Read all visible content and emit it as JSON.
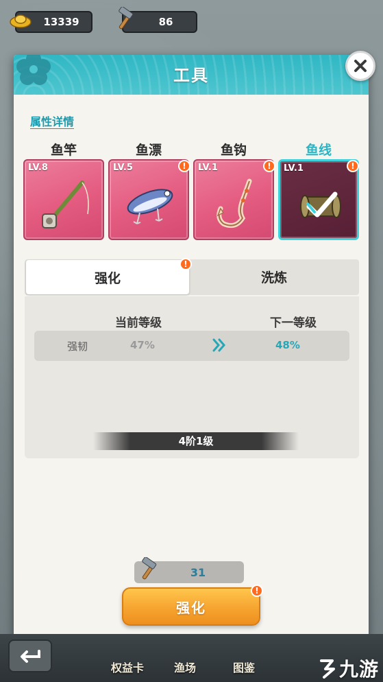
{
  "resources": {
    "gold": "13339",
    "hammers": "86"
  },
  "dialog": {
    "title": "工具",
    "section_link": "属性详情",
    "categories": [
      {
        "label": "鱼竿",
        "level": "LV.8",
        "alert": false,
        "selected": false,
        "icon": "fishing-rod-icon"
      },
      {
        "label": "鱼漂",
        "level": "LV.5",
        "alert": true,
        "selected": false,
        "icon": "lure-icon"
      },
      {
        "label": "鱼钩",
        "level": "LV.1",
        "alert": true,
        "selected": false,
        "icon": "hook-icon"
      },
      {
        "label": "鱼线",
        "level": "LV.1",
        "alert": true,
        "selected": true,
        "icon": "line-spool-icon"
      }
    ],
    "tabs": [
      {
        "label": "强化",
        "active": true,
        "alert": true
      },
      {
        "label": "洗炼",
        "active": false,
        "alert": false
      }
    ],
    "stats": {
      "current_header": "当前等级",
      "next_header": "下一等级",
      "rows": [
        {
          "name": "强韧",
          "current": "47%",
          "next": "48%"
        }
      ],
      "tier": "4阶1级"
    },
    "cost": "31",
    "upgrade_label": "强化",
    "alert_mark": "!"
  },
  "bottom_nav": {
    "items": [
      "权益卡",
      "渔场",
      "图鉴"
    ]
  },
  "watermark": "九游",
  "colors": {
    "accent_teal": "#2fb7c4",
    "card_pink": "#e45b80",
    "selected_card": "#571f35",
    "button_orange": "#f6a430",
    "alert_orange": "#ff6a1e"
  }
}
